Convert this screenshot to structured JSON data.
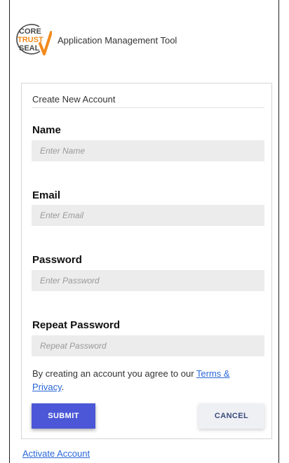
{
  "header": {
    "logo_text": "CORE TRUST SEAL",
    "app_title": "Application Management Tool"
  },
  "form": {
    "title": "Create New Account",
    "fields": [
      {
        "label": "Name",
        "placeholder": "Enter Name",
        "value": ""
      },
      {
        "label": "Email",
        "placeholder": "Enter Email",
        "value": ""
      },
      {
        "label": "Password",
        "placeholder": "Enter Password",
        "value": ""
      },
      {
        "label": "Repeat Password",
        "placeholder": "Repeat Password",
        "value": ""
      }
    ],
    "agree_text": "By creating an account you agree to our ",
    "terms_link": "Terms & Privacy",
    "agree_end": ".",
    "submit_label": "SUBMIT",
    "cancel_label": "CANCEL"
  },
  "footer": {
    "activate_link": "Activate Account"
  },
  "colors": {
    "submit": "#4b57d6",
    "link": "#2a67d6",
    "logo_orange": "#f28a1c",
    "logo_gray": "#4a4a4a"
  }
}
